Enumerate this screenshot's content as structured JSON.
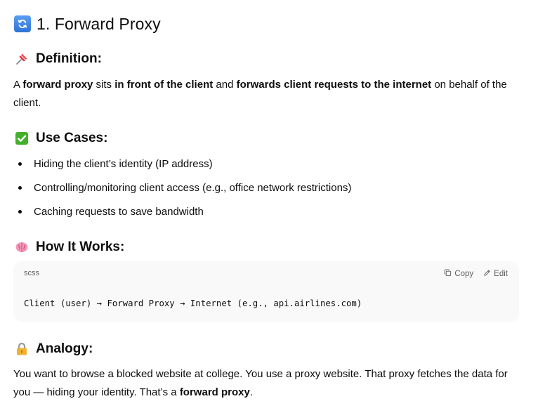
{
  "heading": {
    "title": "1. Forward Proxy",
    "icon": "counterclockwise-arrows-icon"
  },
  "definition": {
    "title": "Definition:",
    "icon": "pushpin-icon",
    "parts": [
      "A ",
      "forward proxy",
      " sits ",
      "in front of the client",
      " and ",
      "forwards client requests to the internet",
      " on behalf of the client."
    ]
  },
  "use_cases": {
    "title": "Use Cases:",
    "icon": "check-mark-button-icon",
    "items": [
      "Hiding the client’s identity (IP address)",
      "Controlling/monitoring client access (e.g., office network restrictions)",
      "Caching requests to save bandwidth"
    ]
  },
  "how_it_works": {
    "title": "How It Works:",
    "icon": "brain-icon",
    "code": {
      "language": "scss",
      "copy_label": "Copy",
      "edit_label": "Edit",
      "content": "Client (user) → Forward Proxy → Internet (e.g., api.airlines.com)"
    }
  },
  "analogy": {
    "title": "Analogy:",
    "icon": "padlock-icon",
    "parts": [
      "You want to browse a blocked website at college. You use a proxy website. That proxy fetches the data for you — hiding your identity. That’s a ",
      "forward proxy",
      "."
    ]
  }
}
